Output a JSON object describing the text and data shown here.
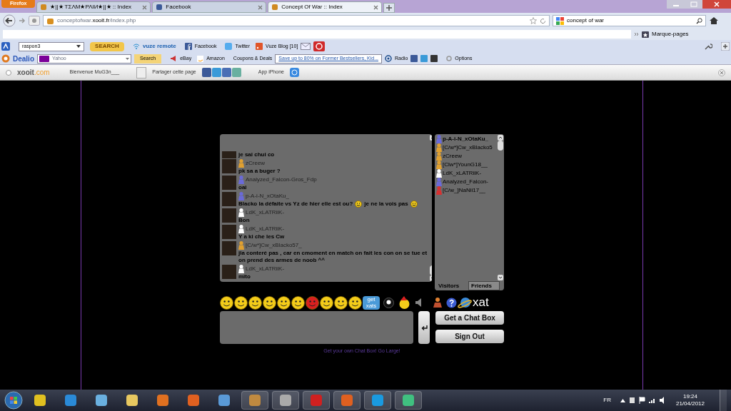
{
  "browser": {
    "menu_button": "Firefox",
    "tabs": [
      {
        "title": "★||★ ΤΣΛΜ★ΡΛΙИ★||★ :: Index",
        "selected": false
      },
      {
        "title": "Facebook",
        "selected": false
      },
      {
        "title": "Concept Of War :: Index",
        "selected": true
      }
    ],
    "url_host": "conceptofwar.",
    "url_domain": "xooit.fr",
    "url_path": "/index.php",
    "search_value": "concept of war",
    "bookmarks_label": "Marque-pages"
  },
  "toolbar": {
    "search_value": "raspon3",
    "search_button": "SEARCH",
    "vuze": "vuze remote",
    "facebook": "Facebook",
    "twitter": "Twitter",
    "vuze_blog": "Vuze Blog [10]"
  },
  "dealio": {
    "brand": "Dealio",
    "engine": "Yahoo",
    "search_button": "Search",
    "ebay": "eBay",
    "amazon": "Amazon",
    "coupons": "Coupons & Deals",
    "promo": "Save up to 80% on Former Bestsellers, Kid...",
    "radio": "Radio",
    "options": "Options"
  },
  "xooit_bar": {
    "logo": "xooit",
    "logo_suffix": ".com",
    "welcome": "Bienvenue MuG3n___",
    "share": "Partager cette page",
    "app": "App iPhone"
  },
  "chat": {
    "messages": [
      {
        "parts": [
          {
            "kind": "text",
            "text": "je sai chui co"
          }
        ]
      },
      {
        "name": "zCreew",
        "color": "#e0a030",
        "parts": [
          {
            "kind": "text",
            "text": "pk sa a buger ?"
          }
        ]
      },
      {
        "name": "Analyzed_Falcon-Gros_Fdp",
        "color": "#6a6ad8",
        "parts": [
          {
            "kind": "text",
            "text": "oai"
          }
        ]
      },
      {
        "name": "p-A-i-N_xOtaKu_",
        "color": "#6a6ad8",
        "parts": [
          {
            "kind": "text",
            "text": "Blacko la défaite vs Yz de hier elle est ou?"
          },
          {
            "kind": "smiley"
          },
          {
            "kind": "text",
            "text": "je ne la vois pas"
          },
          {
            "kind": "smiley"
          }
        ]
      },
      {
        "name": "LdK_xLATRiiK-",
        "color": "#ffffff",
        "parts": [
          {
            "kind": "text",
            "text": "Bon"
          }
        ]
      },
      {
        "name": "LdK_xLATRiiK-",
        "color": "#ffffff",
        "parts": [
          {
            "kind": "text",
            "text": "Y a ki che les Cw"
          }
        ]
      },
      {
        "name": "[C/w*]Cw_xBlacko57_",
        "color": "#e0a030",
        "parts": [
          {
            "kind": "text",
            "text": "jla conteré pas , car en cmoment en match on fait les con on se tue et on prend des armes de noob ^^"
          }
        ]
      },
      {
        "name": "LdK_xLATRiiK-",
        "color": "#ffffff",
        "parts": [
          {
            "kind": "text",
            "text": "mito"
          }
        ]
      }
    ],
    "users": [
      {
        "name": "p-A-i-N_xOtaKu_",
        "color": "#6a6ad8",
        "bold": true
      },
      {
        "name": "[C/w*]Cw_xBlacko5",
        "color": "#e0a030",
        "bold": false
      },
      {
        "name": "zCreew",
        "color": "#e0a030",
        "bold": false
      },
      {
        "name": "[Clw*]YounG18__",
        "color": "#e0a030",
        "bold": false
      },
      {
        "name": "LdK_xLATRiiK-",
        "color": "#ffffff",
        "bold": false
      },
      {
        "name": "Analyzed_Falcon-",
        "color": "#6a6ad8",
        "bold": false
      },
      {
        "name": "[C/w_]NaNii17__",
        "color": "#d83030",
        "bold": false
      }
    ],
    "list_tabs": [
      {
        "label": "Visitors",
        "selected": false
      },
      {
        "label": "Friends",
        "selected": true
      }
    ],
    "getxats": "get xats",
    "brand": "xat",
    "buttons": [
      "Get a Chat Box",
      "Sign Out"
    ],
    "footer_link": "Get your own Chat Box! Go Large!"
  },
  "taskbar": {
    "language": "FR",
    "time": "19:24",
    "date": "21/04/2012"
  }
}
